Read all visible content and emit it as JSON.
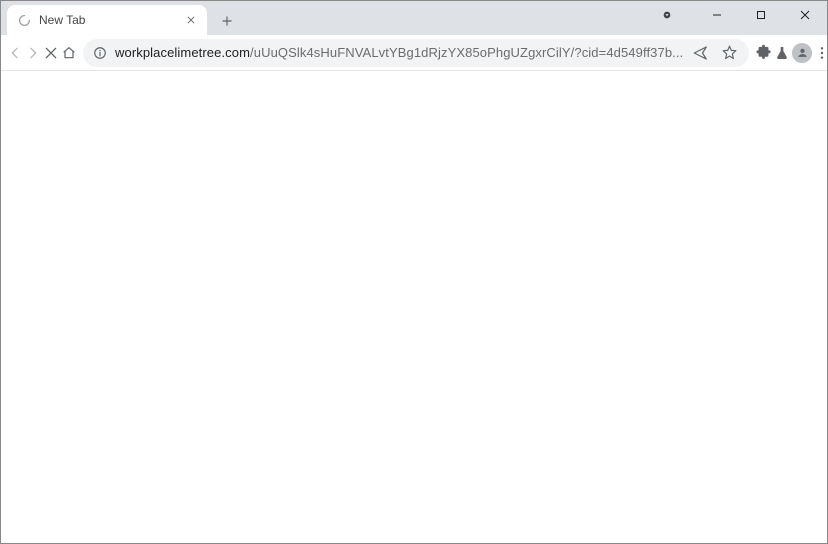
{
  "tab": {
    "title": "New Tab",
    "loading": true
  },
  "url": {
    "domain": "workplacelimetree.com",
    "path_display": "/uUuQSlk4sHuFNVALvtYBg1dRjzYX85oPhgUZgxrCilY/?cid=4d549ff37b..."
  }
}
